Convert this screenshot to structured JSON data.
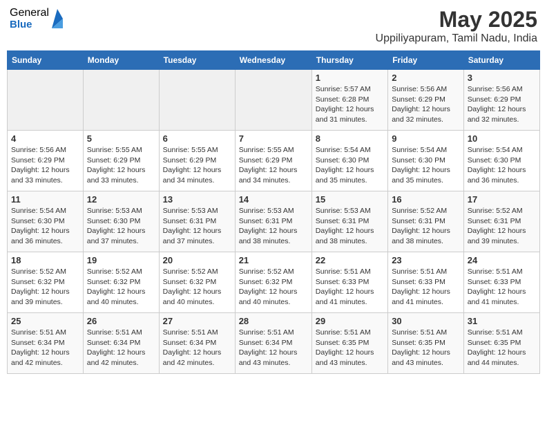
{
  "header": {
    "logo_general": "General",
    "logo_blue": "Blue",
    "month_title": "May 2025",
    "location": "Uppiliyapuram, Tamil Nadu, India"
  },
  "days_of_week": [
    "Sunday",
    "Monday",
    "Tuesday",
    "Wednesday",
    "Thursday",
    "Friday",
    "Saturday"
  ],
  "weeks": [
    [
      {
        "day": "",
        "info": ""
      },
      {
        "day": "",
        "info": ""
      },
      {
        "day": "",
        "info": ""
      },
      {
        "day": "",
        "info": ""
      },
      {
        "day": "1",
        "info": "Sunrise: 5:57 AM\nSunset: 6:28 PM\nDaylight: 12 hours\nand 31 minutes."
      },
      {
        "day": "2",
        "info": "Sunrise: 5:56 AM\nSunset: 6:29 PM\nDaylight: 12 hours\nand 32 minutes."
      },
      {
        "day": "3",
        "info": "Sunrise: 5:56 AM\nSunset: 6:29 PM\nDaylight: 12 hours\nand 32 minutes."
      }
    ],
    [
      {
        "day": "4",
        "info": "Sunrise: 5:56 AM\nSunset: 6:29 PM\nDaylight: 12 hours\nand 33 minutes."
      },
      {
        "day": "5",
        "info": "Sunrise: 5:55 AM\nSunset: 6:29 PM\nDaylight: 12 hours\nand 33 minutes."
      },
      {
        "day": "6",
        "info": "Sunrise: 5:55 AM\nSunset: 6:29 PM\nDaylight: 12 hours\nand 34 minutes."
      },
      {
        "day": "7",
        "info": "Sunrise: 5:55 AM\nSunset: 6:29 PM\nDaylight: 12 hours\nand 34 minutes."
      },
      {
        "day": "8",
        "info": "Sunrise: 5:54 AM\nSunset: 6:30 PM\nDaylight: 12 hours\nand 35 minutes."
      },
      {
        "day": "9",
        "info": "Sunrise: 5:54 AM\nSunset: 6:30 PM\nDaylight: 12 hours\nand 35 minutes."
      },
      {
        "day": "10",
        "info": "Sunrise: 5:54 AM\nSunset: 6:30 PM\nDaylight: 12 hours\nand 36 minutes."
      }
    ],
    [
      {
        "day": "11",
        "info": "Sunrise: 5:54 AM\nSunset: 6:30 PM\nDaylight: 12 hours\nand 36 minutes."
      },
      {
        "day": "12",
        "info": "Sunrise: 5:53 AM\nSunset: 6:30 PM\nDaylight: 12 hours\nand 37 minutes."
      },
      {
        "day": "13",
        "info": "Sunrise: 5:53 AM\nSunset: 6:31 PM\nDaylight: 12 hours\nand 37 minutes."
      },
      {
        "day": "14",
        "info": "Sunrise: 5:53 AM\nSunset: 6:31 PM\nDaylight: 12 hours\nand 38 minutes."
      },
      {
        "day": "15",
        "info": "Sunrise: 5:53 AM\nSunset: 6:31 PM\nDaylight: 12 hours\nand 38 minutes."
      },
      {
        "day": "16",
        "info": "Sunrise: 5:52 AM\nSunset: 6:31 PM\nDaylight: 12 hours\nand 38 minutes."
      },
      {
        "day": "17",
        "info": "Sunrise: 5:52 AM\nSunset: 6:31 PM\nDaylight: 12 hours\nand 39 minutes."
      }
    ],
    [
      {
        "day": "18",
        "info": "Sunrise: 5:52 AM\nSunset: 6:32 PM\nDaylight: 12 hours\nand 39 minutes."
      },
      {
        "day": "19",
        "info": "Sunrise: 5:52 AM\nSunset: 6:32 PM\nDaylight: 12 hours\nand 40 minutes."
      },
      {
        "day": "20",
        "info": "Sunrise: 5:52 AM\nSunset: 6:32 PM\nDaylight: 12 hours\nand 40 minutes."
      },
      {
        "day": "21",
        "info": "Sunrise: 5:52 AM\nSunset: 6:32 PM\nDaylight: 12 hours\nand 40 minutes."
      },
      {
        "day": "22",
        "info": "Sunrise: 5:51 AM\nSunset: 6:33 PM\nDaylight: 12 hours\nand 41 minutes."
      },
      {
        "day": "23",
        "info": "Sunrise: 5:51 AM\nSunset: 6:33 PM\nDaylight: 12 hours\nand 41 minutes."
      },
      {
        "day": "24",
        "info": "Sunrise: 5:51 AM\nSunset: 6:33 PM\nDaylight: 12 hours\nand 41 minutes."
      }
    ],
    [
      {
        "day": "25",
        "info": "Sunrise: 5:51 AM\nSunset: 6:34 PM\nDaylight: 12 hours\nand 42 minutes."
      },
      {
        "day": "26",
        "info": "Sunrise: 5:51 AM\nSunset: 6:34 PM\nDaylight: 12 hours\nand 42 minutes."
      },
      {
        "day": "27",
        "info": "Sunrise: 5:51 AM\nSunset: 6:34 PM\nDaylight: 12 hours\nand 42 minutes."
      },
      {
        "day": "28",
        "info": "Sunrise: 5:51 AM\nSunset: 6:34 PM\nDaylight: 12 hours\nand 43 minutes."
      },
      {
        "day": "29",
        "info": "Sunrise: 5:51 AM\nSunset: 6:35 PM\nDaylight: 12 hours\nand 43 minutes."
      },
      {
        "day": "30",
        "info": "Sunrise: 5:51 AM\nSunset: 6:35 PM\nDaylight: 12 hours\nand 43 minutes."
      },
      {
        "day": "31",
        "info": "Sunrise: 5:51 AM\nSunset: 6:35 PM\nDaylight: 12 hours\nand 44 minutes."
      }
    ]
  ]
}
